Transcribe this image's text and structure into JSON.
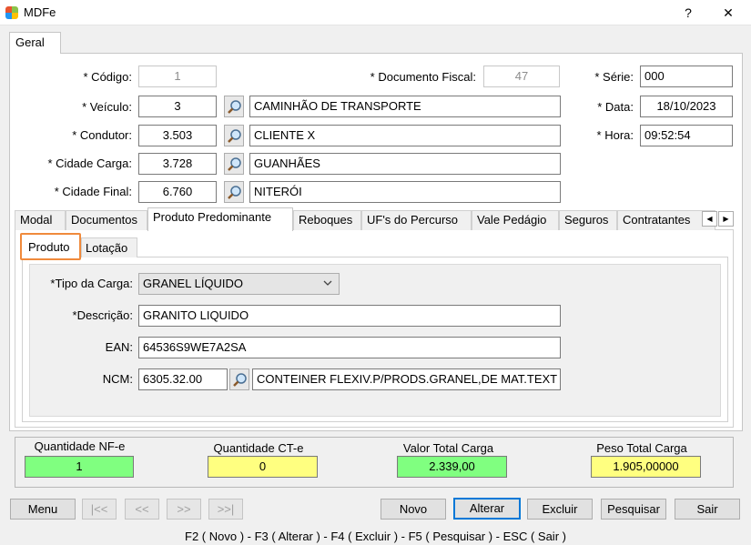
{
  "window": {
    "title": "MDFe",
    "help_glyph": "?",
    "close_glyph": "✕",
    "icon_colors": [
      "#e8542f",
      "#8bc34a",
      "#2196f3",
      "#ffc107"
    ]
  },
  "main_tab": {
    "label": "Geral"
  },
  "header_fields": {
    "codigo": {
      "label": "* Código:",
      "value": "1"
    },
    "documento_fiscal": {
      "label": "* Documento Fiscal:",
      "value": "47"
    },
    "serie": {
      "label": "* Série:",
      "value": "000"
    },
    "veiculo": {
      "label": "* Veículo:",
      "code": "3",
      "description": "CAMINHÃO DE TRANSPORTE"
    },
    "data": {
      "label": "* Data:",
      "value": "18/10/2023"
    },
    "condutor": {
      "label": "* Condutor:",
      "code": "3.503",
      "description": "CLIENTE X"
    },
    "hora": {
      "label": "* Hora:",
      "value": "09:52:54"
    },
    "cidade_carga": {
      "label": "* Cidade Carga:",
      "code": "3.728",
      "description": "GUANHÃES"
    },
    "cidade_final": {
      "label": "* Cidade Final:",
      "code": "6.760",
      "description": "NITERÓI"
    }
  },
  "section_tabs": [
    "Modal",
    "Documentos",
    "Produto Predominante",
    "Reboques",
    "UF's do Percurso",
    "Vale Pedágio",
    "Seguros",
    "Contratantes"
  ],
  "section_tabs_scroll": {
    "left": "◀",
    "right": "▶"
  },
  "sub_tabs": [
    "Produto",
    "Lotação"
  ],
  "produto": {
    "tipo_carga": {
      "label": "*Tipo da Carga:",
      "value": "GRANEL LÍQUIDO"
    },
    "descricao": {
      "label": "*Descrição:",
      "value": "GRANITO LIQUIDO"
    },
    "ean": {
      "label": "EAN:",
      "value": "64536S9WE7A2SA"
    },
    "ncm": {
      "label": "NCM:",
      "code": "6305.32.00",
      "description": "CONTEINER FLEXIV.P/PRODS.GRANEL,DE MAT.TEXT"
    }
  },
  "totals": {
    "qtd_nfe": {
      "label": "Quantidade NF-e",
      "value": "1",
      "color": "#80ff80"
    },
    "qtd_cte": {
      "label": "Quantidade CT-e",
      "value": "0",
      "color": "#ffff80"
    },
    "valor_total": {
      "label": "Valor Total Carga",
      "value": "2.339,00",
      "color": "#80ff80"
    },
    "peso_total": {
      "label": "Peso Total Carga",
      "value": "1.905,00000",
      "color": "#ffff80"
    }
  },
  "buttons": {
    "menu": "Menu",
    "first": "|<<",
    "prev": "<<",
    "next": ">>",
    "last": ">>|",
    "novo": "Novo",
    "alterar": "Alterar",
    "excluir": "Excluir",
    "pesquisar": "Pesquisar",
    "sair": "Sair"
  },
  "status_bar": "F2 ( Novo )  -  F3 ( Alterar )  -  F4 ( Excluir )  -  F5 ( Pesquisar )  -  ESC ( Sair )",
  "highlight_color": "#f08a3c"
}
